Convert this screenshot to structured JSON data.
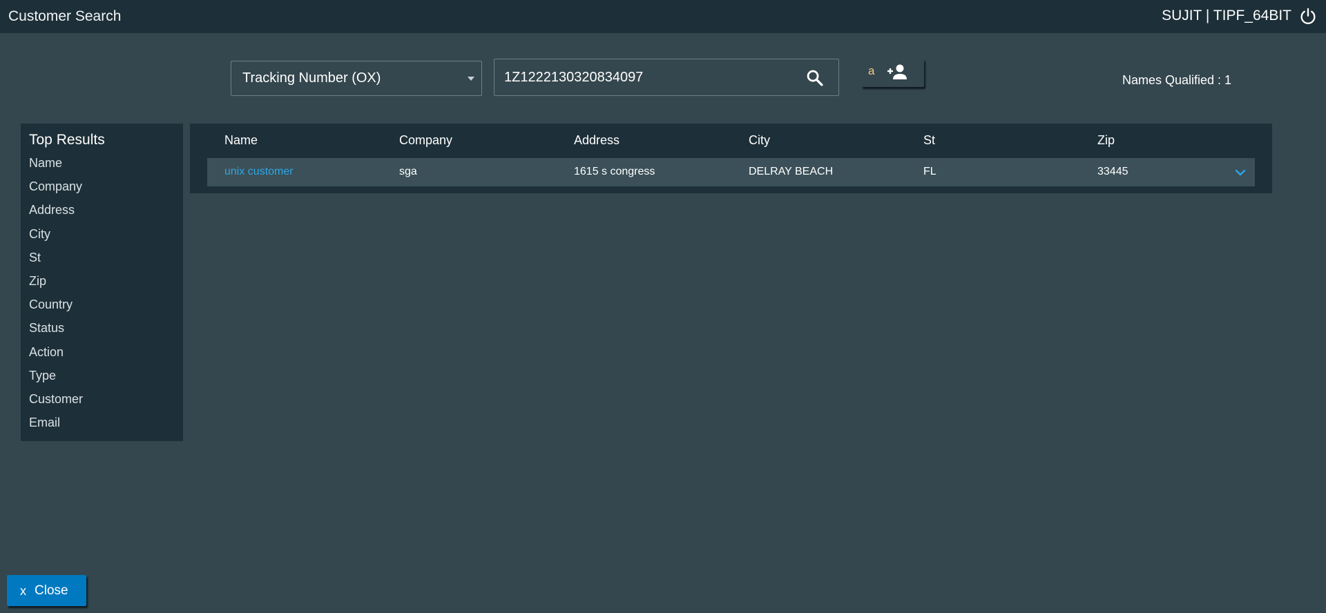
{
  "header": {
    "title": "Customer Search",
    "user": "SUJIT | TIPF_64BIT",
    "power_icon": "power-icon"
  },
  "search": {
    "type_selected": "Tracking Number (OX)",
    "query": "1Z1222130320834097",
    "search_icon": "search-icon",
    "add_button_letter": "a",
    "add_icon": "person-add-icon",
    "names_qualified": "Names Qualified : 1"
  },
  "sidebar": {
    "title": "Top Results",
    "items": [
      {
        "label": "Name"
      },
      {
        "label": "Company"
      },
      {
        "label": "Address"
      },
      {
        "label": "City"
      },
      {
        "label": "St"
      },
      {
        "label": "Zip"
      },
      {
        "label": "Country"
      },
      {
        "label": "Status"
      },
      {
        "label": "Action"
      },
      {
        "label": "Type"
      },
      {
        "label": "Customer"
      },
      {
        "label": "Email"
      }
    ]
  },
  "results": {
    "columns": [
      "Name",
      "Company",
      "Address",
      "City",
      "St",
      "Zip"
    ],
    "rows": [
      {
        "name": "unix customer",
        "company": "sga",
        "address": "1615 s congress",
        "city": "DELRAY BEACH",
        "st": "FL",
        "zip": "33445"
      }
    ]
  },
  "footer": {
    "close_x": "x",
    "close_label": "Close"
  },
  "colors": {
    "background": "#34464e",
    "panel": "#1d2f38",
    "row": "#3b5058",
    "link": "#2fa6e6",
    "primary_button": "#0179c1"
  }
}
